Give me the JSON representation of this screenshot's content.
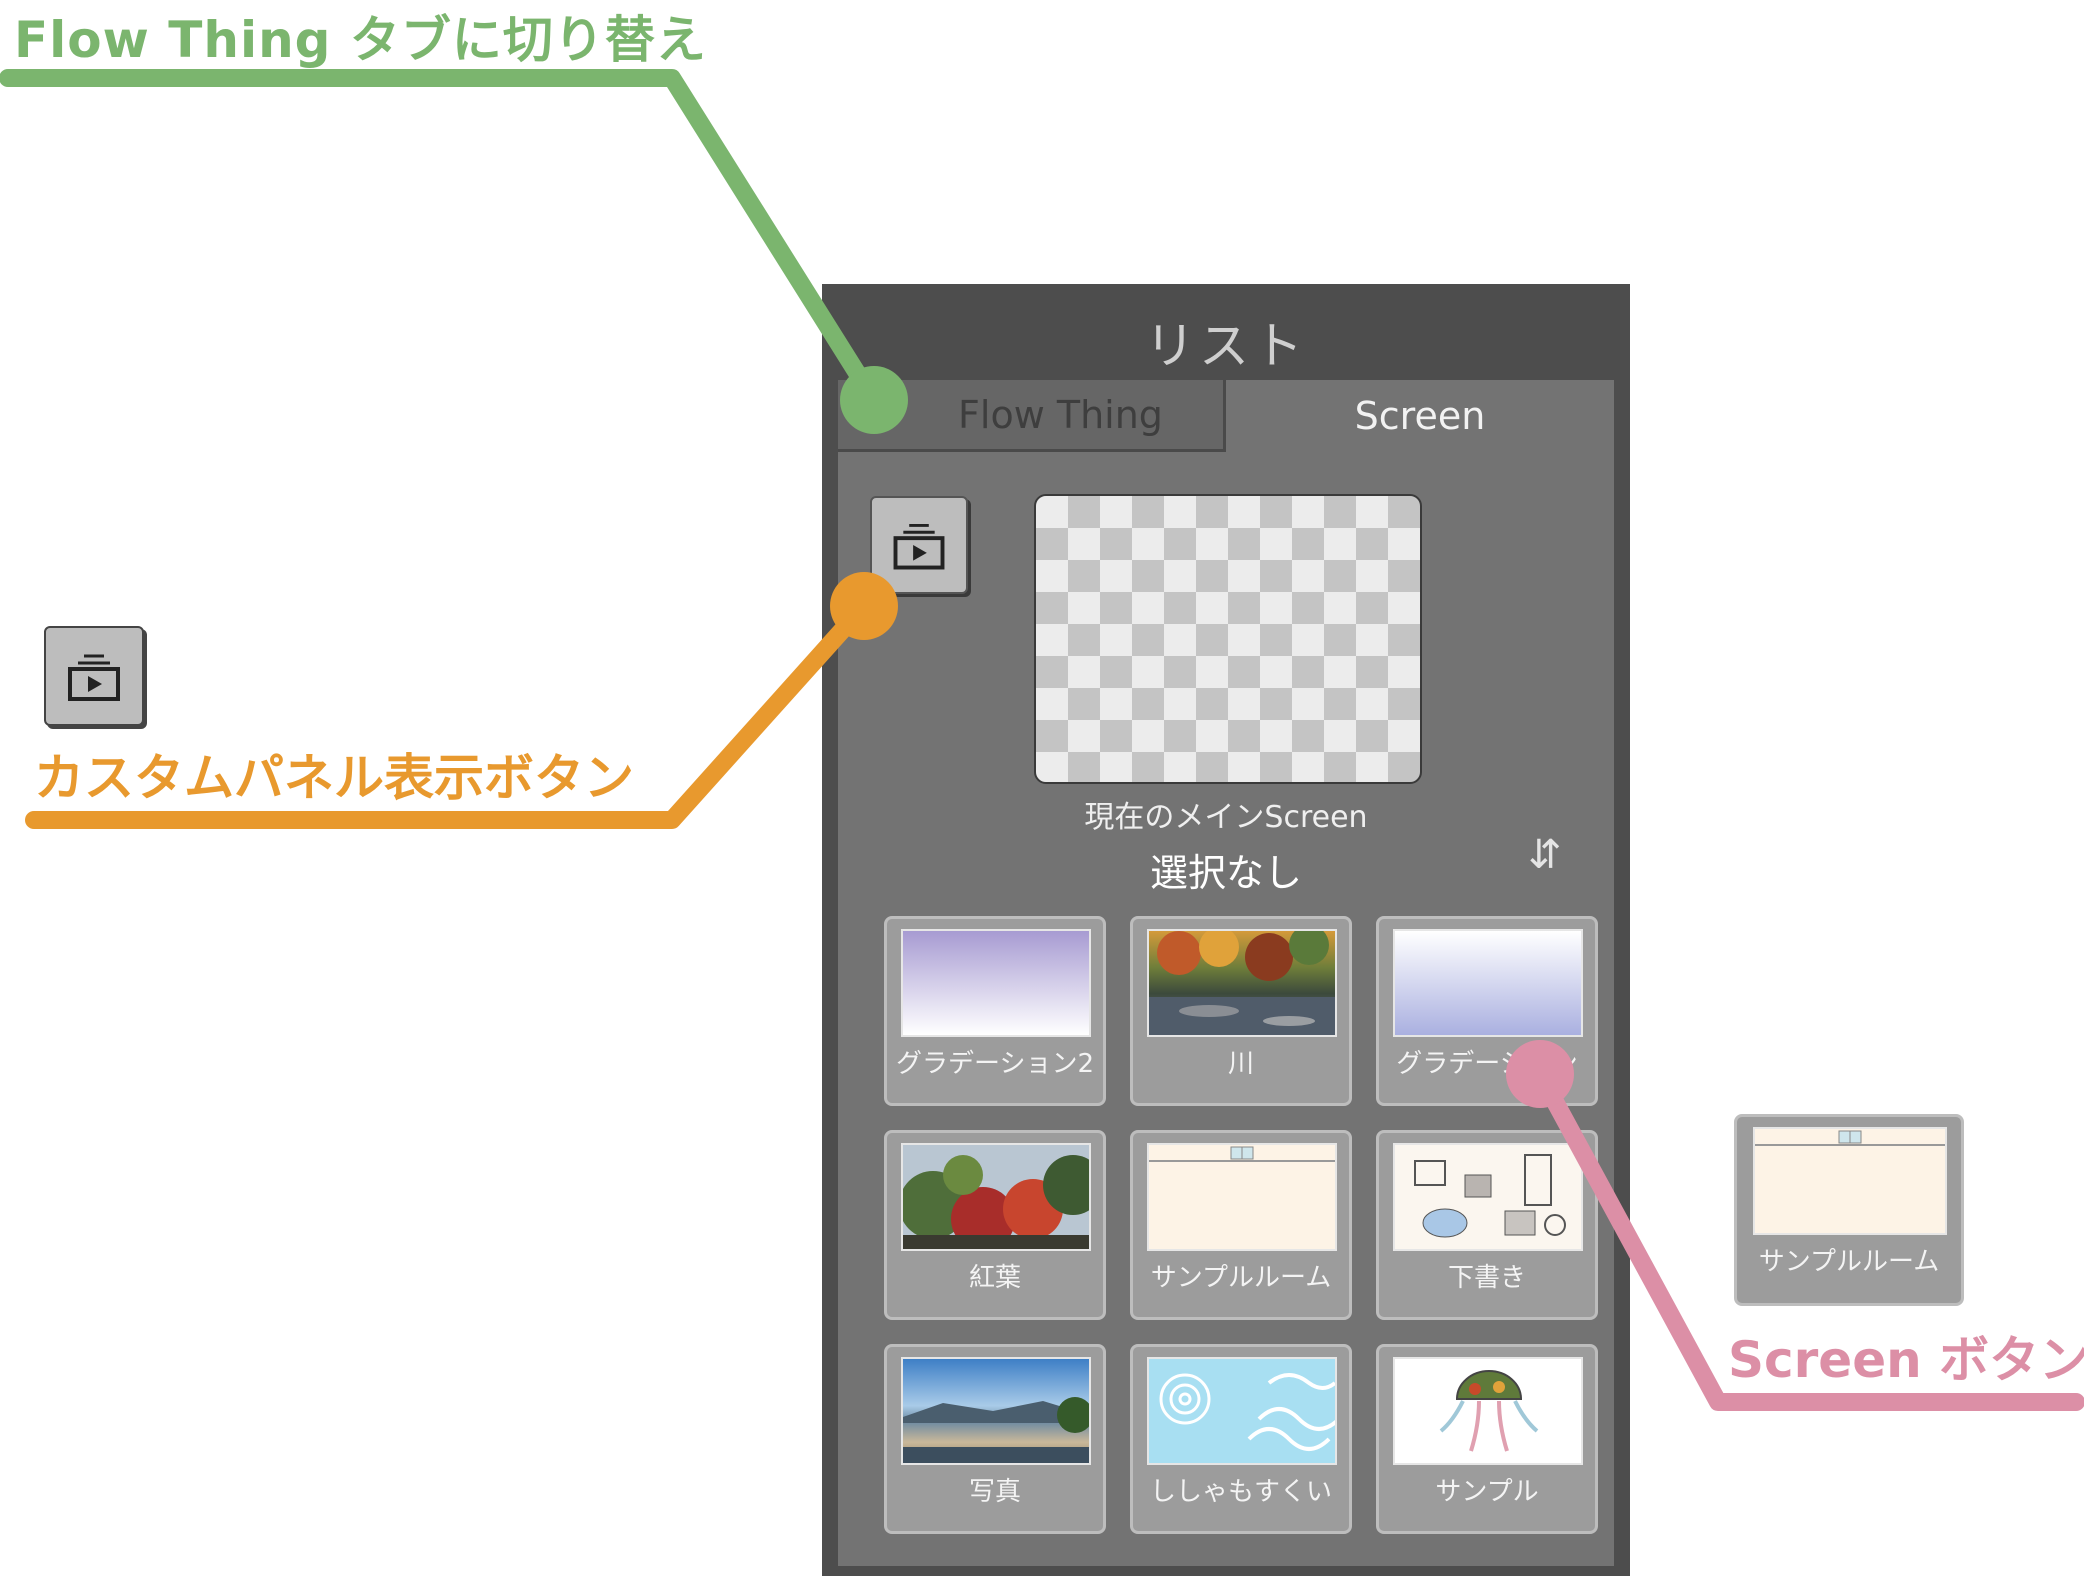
{
  "annotations": {
    "flow_thing": "Flow Thing タブに切り替え",
    "custom_panel": "カスタムパネル表示ボタン",
    "screen_button": "Screen ボタン",
    "colors": {
      "green": "#7bb56e",
      "orange": "#e8992e",
      "pink": "#dc8fa6"
    }
  },
  "panel": {
    "title": "リスト",
    "tabs": [
      {
        "label": "Flow Thing",
        "active": false
      },
      {
        "label": "Screen",
        "active": true
      }
    ],
    "custom_button_icon": "play-stack-icon",
    "main_screen_label": "現在のメインScreen",
    "main_screen_value": "選択なし",
    "sort_icon": "⇵",
    "screens": [
      {
        "label": "グラデーション2"
      },
      {
        "label": "川"
      },
      {
        "label": "グラデーション"
      },
      {
        "label": "紅葉"
      },
      {
        "label": "サンプルルーム"
      },
      {
        "label": "下書き"
      },
      {
        "label": "写真"
      },
      {
        "label": "ししゃもすくい"
      },
      {
        "label": "サンプル"
      }
    ]
  },
  "example_card": {
    "label": "サンプルルーム"
  }
}
